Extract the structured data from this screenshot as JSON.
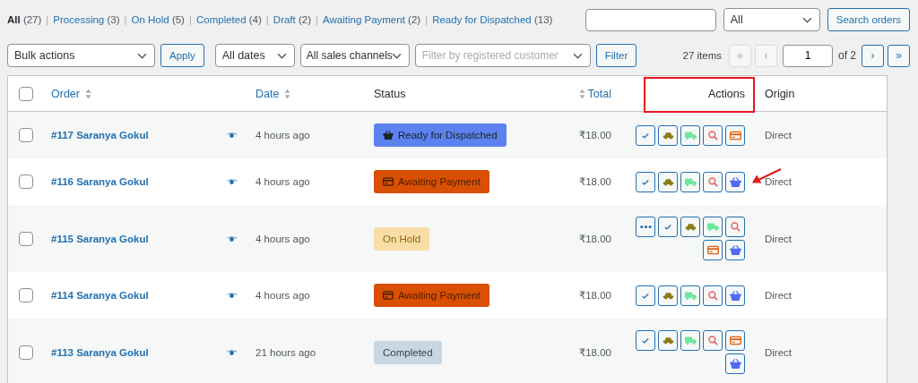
{
  "status_filters": [
    {
      "label": "All",
      "count": "(27)",
      "selected": true
    },
    {
      "separator": "|",
      "label": "Processing",
      "count": "(3)",
      "selected": false
    },
    {
      "separator": "|",
      "label": "On Hold",
      "count": "(5)",
      "selected": false
    },
    {
      "separator": "|",
      "label": "Completed",
      "count": "(4)",
      "selected": false
    },
    {
      "separator": "|",
      "label": "Draft",
      "count": "(2)",
      "selected": false
    },
    {
      "separator": "|",
      "label": "Awaiting Payment",
      "count": "(2)",
      "selected": false
    },
    {
      "separator": "|",
      "label": "Ready for Dispatched",
      "count": "(13)",
      "selected": false
    }
  ],
  "search": {
    "type_select": "All",
    "button": "Search orders"
  },
  "toolbar": {
    "bulk_actions": "Bulk actions",
    "apply": "Apply",
    "dates": "All dates",
    "channels": "All sales channels",
    "customer_placeholder": "Filter by registered customer",
    "filter": "Filter"
  },
  "pagination": {
    "count": "27 items",
    "page": "1",
    "of": "of 2",
    "buttons": [
      {
        "label": "«",
        "disabled": true
      },
      {
        "label": "‹",
        "disabled": true
      },
      {
        "label": "›",
        "disabled": false
      },
      {
        "label": "»",
        "disabled": false
      }
    ]
  },
  "select_all": {
    "checked": false
  },
  "columns": [
    {
      "label": "Order",
      "kind": "sort-after",
      "highlighted": false
    },
    {
      "label": "Date",
      "kind": "sort-after",
      "highlighted": false
    },
    {
      "label": "Status",
      "kind": "plain",
      "highlighted": false
    },
    {
      "label": "Total",
      "kind": "sort-before",
      "highlighted": false
    },
    {
      "label": "Actions",
      "kind": "plain",
      "highlighted": true
    },
    {
      "label": "Origin",
      "kind": "plain",
      "highlighted": false
    }
  ],
  "rows": [
    {
      "checked": false,
      "order": "#117 Saranya Gokul",
      "date": "4 hours ago",
      "status": {
        "label": "Ready for Dispatched",
        "kind": "dispatch"
      },
      "total": "₹18.00",
      "actions": [
        {
          "kind": "check"
        },
        {
          "kind": "car"
        },
        {
          "kind": "truck"
        },
        {
          "kind": "search"
        },
        {
          "kind": "card"
        }
      ],
      "origin": "Direct",
      "pointed": false
    },
    {
      "checked": false,
      "order": "#116 Saranya Gokul",
      "date": "4 hours ago",
      "status": {
        "label": "Awaiting Payment",
        "kind": "awaiting"
      },
      "total": "₹18.00",
      "actions": [
        {
          "kind": "check"
        },
        {
          "kind": "car"
        },
        {
          "kind": "truck"
        },
        {
          "kind": "search"
        },
        {
          "kind": "basket"
        }
      ],
      "origin": "Direct",
      "pointed": true
    },
    {
      "checked": false,
      "order": "#115 Saranya Gokul",
      "date": "4 hours ago",
      "status": {
        "label": "On Hold",
        "kind": "on-hold"
      },
      "total": "₹18.00",
      "actions": [
        {
          "kind": "more"
        },
        {
          "kind": "check"
        },
        {
          "kind": "car"
        },
        {
          "kind": "truck"
        },
        {
          "kind": "search"
        },
        {
          "kind": "card"
        },
        {
          "kind": "basket"
        }
      ],
      "origin": "Direct",
      "pointed": false
    },
    {
      "checked": false,
      "order": "#114 Saranya Gokul",
      "date": "4 hours ago",
      "status": {
        "label": "Awaiting Payment",
        "kind": "awaiting"
      },
      "total": "₹18.00",
      "actions": [
        {
          "kind": "check"
        },
        {
          "kind": "car"
        },
        {
          "kind": "truck"
        },
        {
          "kind": "search"
        },
        {
          "kind": "basket"
        }
      ],
      "origin": "Direct",
      "pointed": false
    },
    {
      "checked": false,
      "order": "#113 Saranya Gokul",
      "date": "21 hours ago",
      "status": {
        "label": "Completed",
        "kind": "completed"
      },
      "total": "₹18.00",
      "actions": [
        {
          "kind": "check"
        },
        {
          "kind": "car"
        },
        {
          "kind": "truck"
        },
        {
          "kind": "search"
        },
        {
          "kind": "card"
        },
        {
          "kind": "basket"
        }
      ],
      "origin": "Direct",
      "pointed": false
    }
  ]
}
